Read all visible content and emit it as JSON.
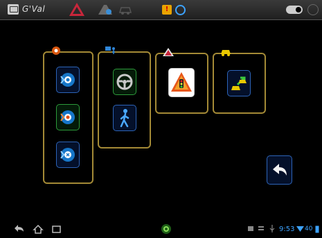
{
  "status_bar": {
    "app_title": "G'Val"
  },
  "nav_bar": {
    "time": "9:53",
    "battery": "40"
  },
  "colors": {
    "accent_blue": "#3da3ff",
    "group_border": "#a48a36",
    "warning_red": "#c8263b"
  },
  "groups": [
    {
      "name": "sensors",
      "icon": "eye-warning-icon",
      "tiles": [
        "sensor-blue-icon",
        "sensor-green-icon",
        "sensor-cross-icon"
      ]
    },
    {
      "name": "driver",
      "icon": "person-camera-icon",
      "tiles": [
        "steering-wheel-icon",
        "pedestrian-icon"
      ]
    },
    {
      "name": "warning",
      "icon": "warning-triangle-icon",
      "tiles": [
        "traffic-light-warning-icon"
      ]
    },
    {
      "name": "vehicles",
      "icon": "car-icon",
      "tiles": [
        "car-transfer-icon"
      ]
    }
  ]
}
